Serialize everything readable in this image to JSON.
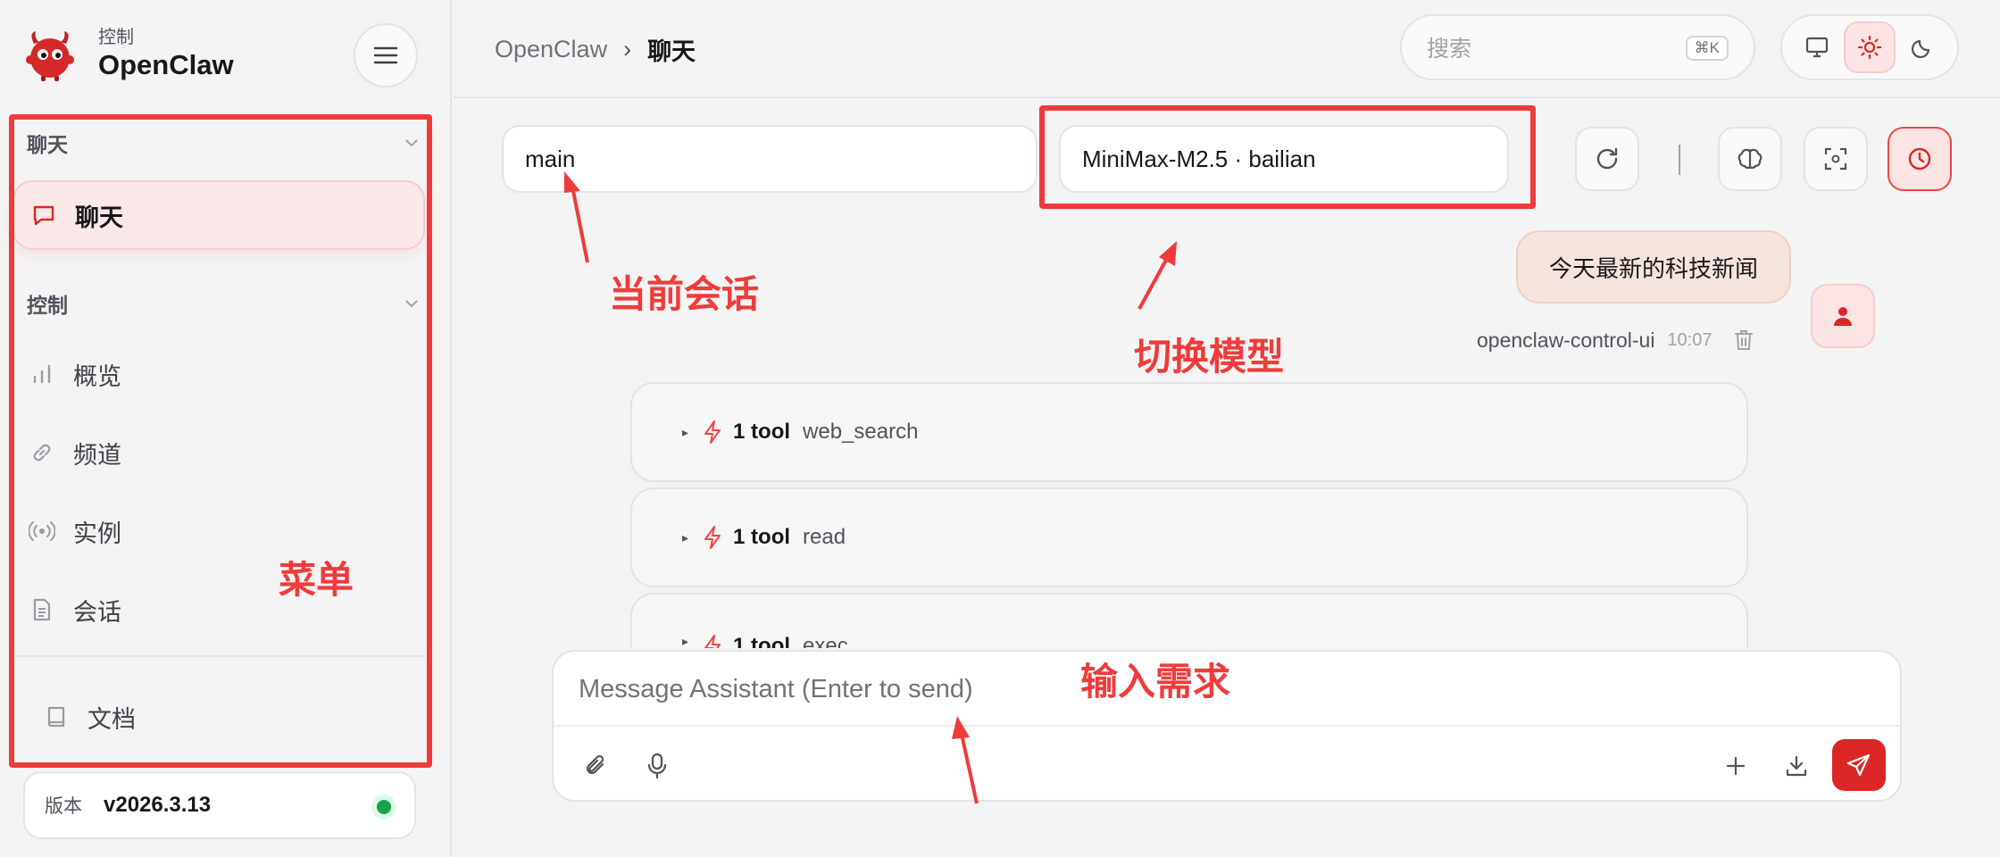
{
  "brand": {
    "subtitle": "控制",
    "title": "OpenClaw"
  },
  "sidebar": {
    "groups": [
      {
        "label": "聊天",
        "items": [
          {
            "label": "聊天",
            "icon": "chat-bubble-icon",
            "active": true
          }
        ]
      },
      {
        "label": "控制",
        "items": [
          {
            "label": "概览",
            "icon": "bar-chart-icon"
          },
          {
            "label": "频道",
            "icon": "link-icon"
          },
          {
            "label": "实例",
            "icon": "broadcast-icon"
          },
          {
            "label": "会话",
            "icon": "document-icon"
          }
        ]
      }
    ],
    "docs": {
      "label": "文档",
      "icon": "book-icon"
    },
    "version": {
      "label": "版本",
      "value": "v2026.3.13",
      "status": "online"
    }
  },
  "topbar": {
    "breadcrumb": [
      "OpenClaw",
      "聊天"
    ],
    "search": {
      "placeholder": "搜索",
      "shortcut": "⌘K"
    },
    "theme": {
      "options": [
        "system",
        "light",
        "dark"
      ],
      "active": "light"
    }
  },
  "chat": {
    "session": "main",
    "model": "MiniMax-M2.5 · bailian",
    "messages": [
      {
        "role": "user",
        "text": "今天最新的科技新闻",
        "sender": "openclaw-control-ui",
        "time": "10:07"
      }
    ],
    "tools": [
      {
        "count": "1 tool",
        "name": "web_search"
      },
      {
        "count": "1 tool",
        "name": "read"
      },
      {
        "count": "1 tool",
        "name": "exec"
      }
    ],
    "composer": {
      "placeholder": "Message Assistant (Enter to send)"
    }
  },
  "annotations": {
    "session": "当前会话",
    "model": "切换模型",
    "menu": "菜单",
    "input": "输入需求"
  },
  "colors": {
    "accent": "#dc2626",
    "annotation": "#ef3b3b",
    "status_online": "#16a34a"
  }
}
